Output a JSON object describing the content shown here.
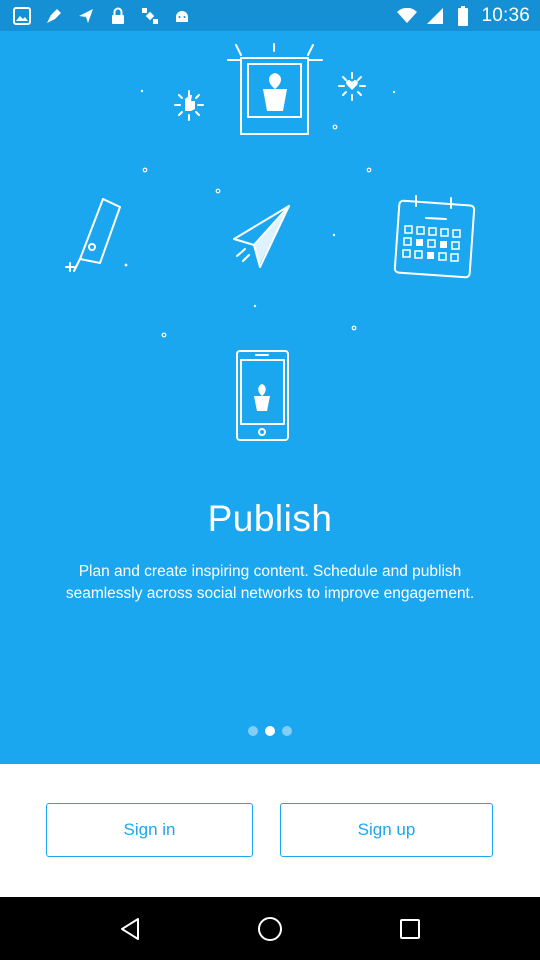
{
  "status_bar": {
    "time": "10:36",
    "icons": [
      "gallery-icon",
      "pen-nib-icon",
      "send-icon",
      "lock-icon",
      "satellite-icon",
      "android-icon",
      "wifi-icon",
      "cellular-icon",
      "battery-icon"
    ]
  },
  "onboarding": {
    "title": "Publish",
    "description": "Plan and create inspiring content. Schedule and publish seamlessly across social networks to improve engagement.",
    "pager": {
      "total": 3,
      "active": 2
    }
  },
  "auth": {
    "sign_in_label": "Sign in",
    "sign_up_label": "Sign up"
  },
  "nav_bar": {
    "icons": [
      "back-icon",
      "home-icon",
      "recents-icon"
    ]
  },
  "colors": {
    "hero_background": "#1aa7f0",
    "status_bar": "#1590d4",
    "accent": "#1aa7f0",
    "nav_bar": "#000000"
  }
}
